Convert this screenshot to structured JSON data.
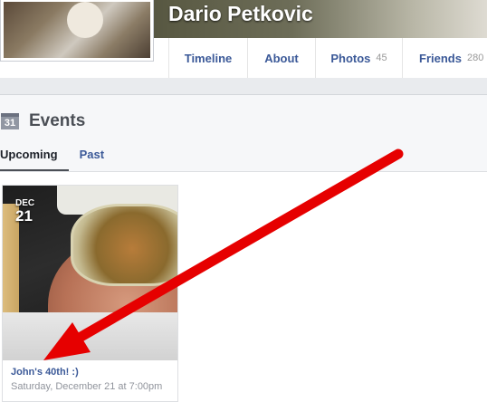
{
  "profile": {
    "name": "Dario Petkovic"
  },
  "nav": {
    "tabs": [
      {
        "label": "Timeline",
        "count": ""
      },
      {
        "label": "About",
        "count": ""
      },
      {
        "label": "Photos",
        "count": "45"
      },
      {
        "label": "Friends",
        "count": "280"
      }
    ]
  },
  "events": {
    "calendar_icon_text": "31",
    "title": "Events",
    "subtabs": {
      "upcoming": "Upcoming",
      "past": "Past"
    },
    "card": {
      "month": "DEC",
      "day": "21",
      "title": "John's 40th! :)",
      "time": "Saturday, December 21 at 7:00pm"
    }
  },
  "annotation": {
    "arrow_color": "#e60000"
  }
}
